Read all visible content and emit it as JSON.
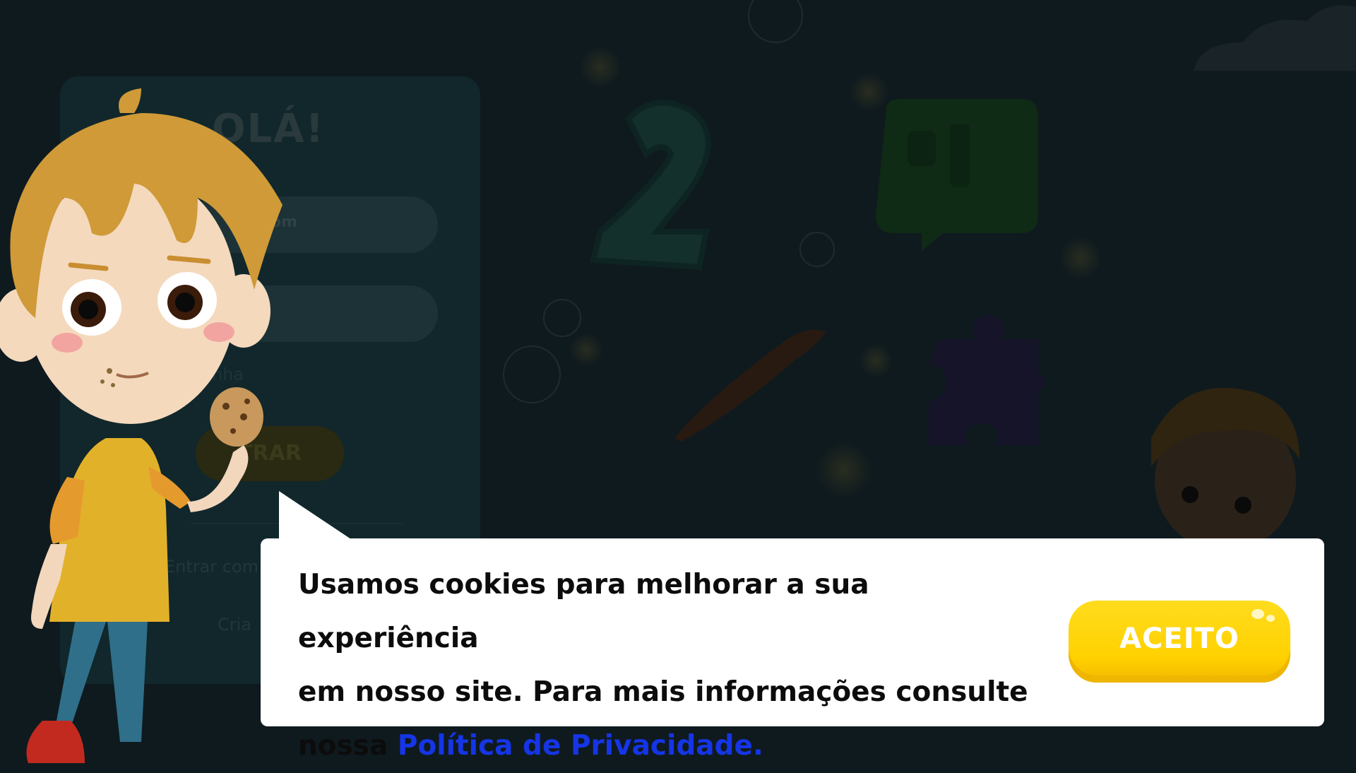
{
  "login": {
    "title": "OLÁ!",
    "email_value": "com",
    "password_value": "",
    "forgot_label": "nha",
    "submit_label": "TRAR",
    "social_label": "Entrar com",
    "create_label": "Cria"
  },
  "cookie_banner": {
    "text_line1": "Usamos cookies para melhorar a sua experiência",
    "text_line2": "em nosso site. Para mais informações consulte",
    "text_line3_prefix": "nossa ",
    "privacy_link": "Política de Privacidade.",
    "accept_label": "ACEITO"
  },
  "background": {
    "number_icon_label": "2"
  },
  "colors": {
    "accent_yellow": "#ffd100",
    "link_blue": "#1535e6",
    "overlay_dark": "#0f1a1f"
  },
  "icons": {
    "number_tile": "number-two-icon",
    "speech": "speech-bubble-icon",
    "brush": "paintbrush-icon",
    "puzzle": "puzzle-piece-icon",
    "cookie": "cookie-icon"
  }
}
